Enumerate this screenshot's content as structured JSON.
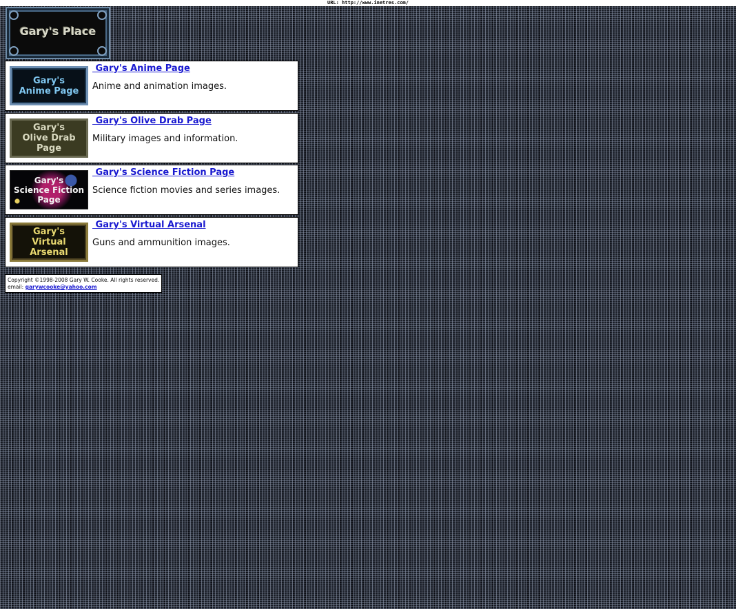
{
  "url_bar": {
    "text": "URL: http://www.inetres.com/"
  },
  "logo": {
    "text": "Gary's Place"
  },
  "links": [
    {
      "title": " Gary's Anime Page",
      "description": "Anime and animation images.",
      "thumb_text": "Gary's\nAnime Page"
    },
    {
      "title": " Gary's Olive Drab Page",
      "description": "Military images and information.",
      "thumb_text": "Gary's\nOlive Drab\nPage"
    },
    {
      "title": " Gary's Science Fiction Page",
      "description": "Science fiction movies and series images.",
      "thumb_text": "Gary's\nScience Fiction\nPage"
    },
    {
      "title": " Gary's Virtual Arsenal",
      "description": "Guns and ammunition images.",
      "thumb_text": "Gary's\nVirtual\nArsenal"
    }
  ],
  "footer": {
    "copyright": "Copyright ©1998-2008 Gary W. Cooke. All rights reserved.",
    "email_label": "email: ",
    "email": "garywcooke@yahoo.com"
  }
}
